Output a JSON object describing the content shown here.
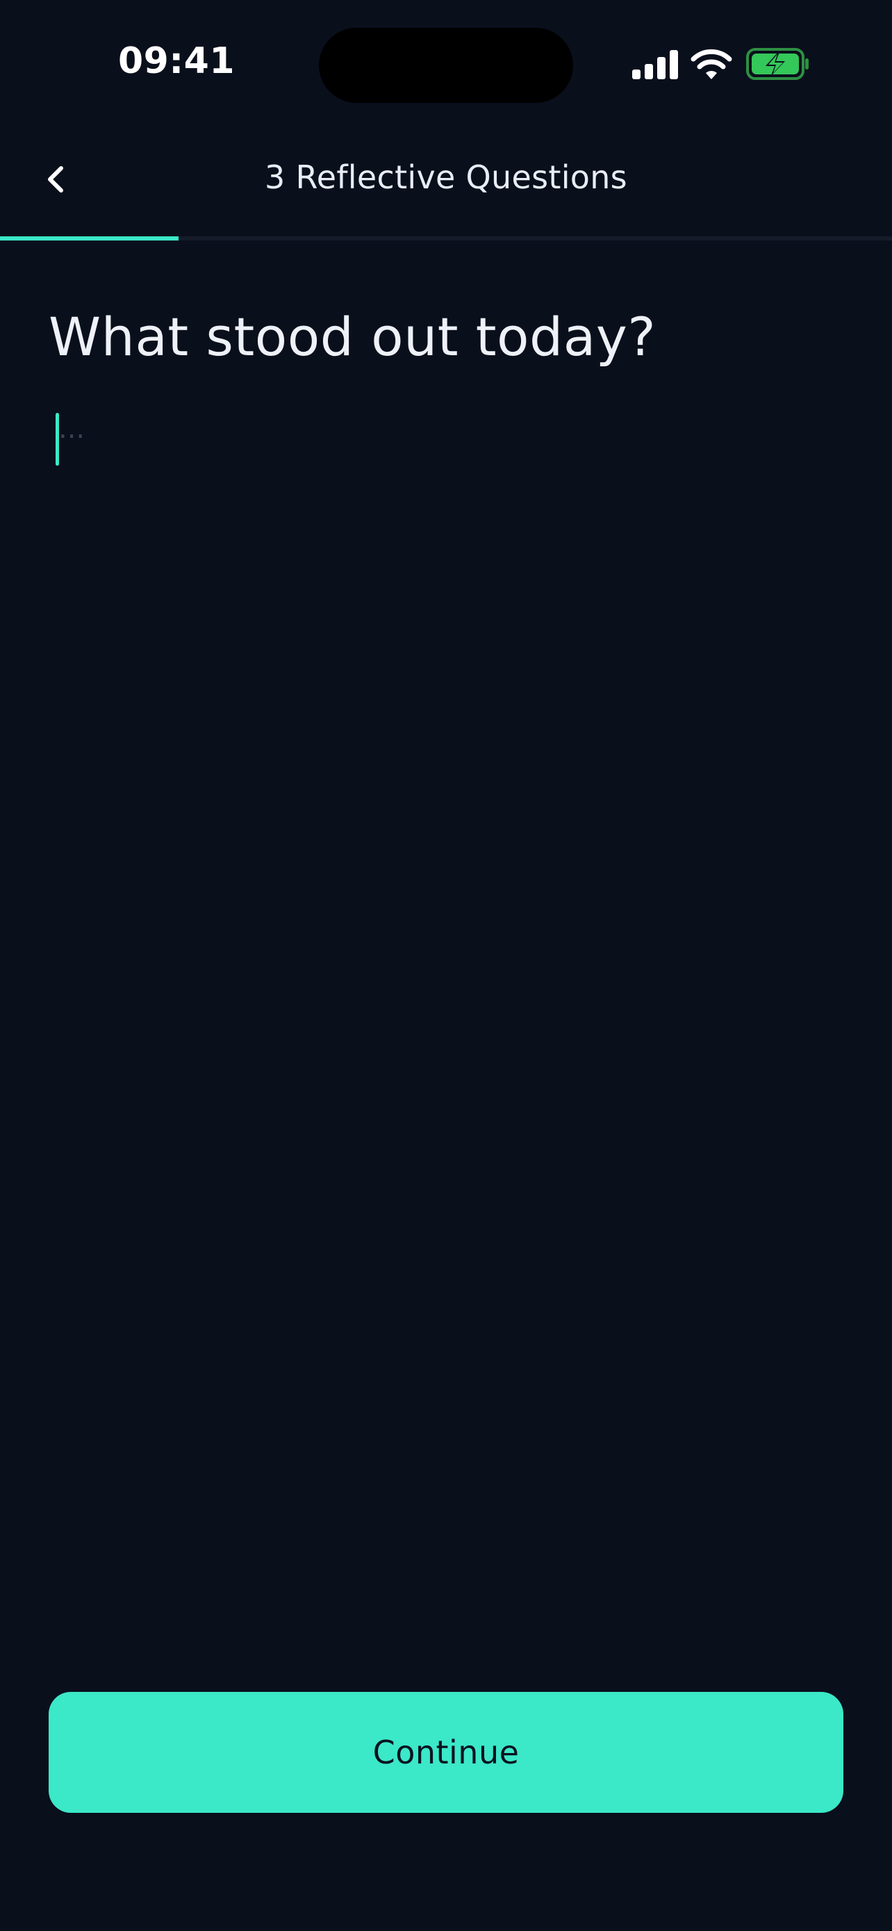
{
  "status_bar": {
    "time": "09:41",
    "icons": [
      "signal-icon",
      "wifi-icon",
      "battery-charging-icon"
    ],
    "battery_color": "#34C759"
  },
  "nav": {
    "back_icon": "chevron-left-icon",
    "title": "3 Reflective Questions"
  },
  "progress": {
    "fraction": 0.2,
    "accent_color": "#3BE8C8"
  },
  "question": {
    "title": "What stood out today?"
  },
  "answer": {
    "placeholder": "...",
    "value": ""
  },
  "footer": {
    "continue_label": "Continue"
  },
  "colors": {
    "background": "#0A0F1C",
    "accent": "#3BE8C8",
    "text": "#EEF1F7"
  }
}
